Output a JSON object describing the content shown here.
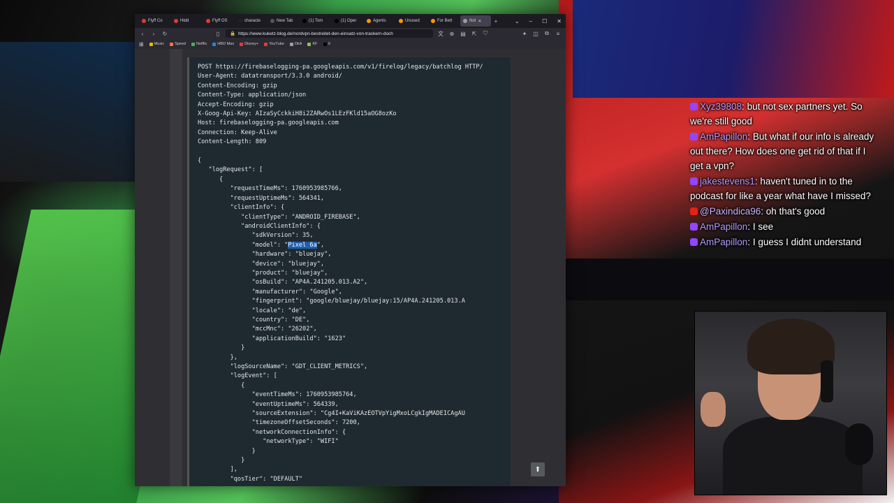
{
  "browser": {
    "tabs": [
      {
        "label": "Flyff Co",
        "color": "#e53935"
      },
      {
        "label": "Hidd",
        "color": "#e53935"
      },
      {
        "label": "Flyff OS",
        "color": "#e53935"
      },
      {
        "label": "characte",
        "color": "#222222"
      },
      {
        "label": "New Tab",
        "color": "#555555"
      },
      {
        "label": "(1) Tom",
        "color": "#000000"
      },
      {
        "label": "(1) Oper",
        "color": "#000000"
      },
      {
        "label": "Agents",
        "color": "#ff9800"
      },
      {
        "label": "Unused",
        "color": "#ff9800"
      },
      {
        "label": "For Bett",
        "color": "#ff9800"
      },
      {
        "label": "Not",
        "color": "#9e9e9e",
        "active": true
      }
    ],
    "url": "https://www.kuketz-blog.de/nordvpn-bestreitet-den-einsatz-von-trackern-doch",
    "bookmarks": [
      {
        "label": "Music",
        "color": "#f4b400"
      },
      {
        "label": "Speed",
        "color": "#ff7043"
      },
      {
        "label": "Netflix",
        "color": "#4caf50"
      },
      {
        "label": "HBO Max",
        "color": "#1e88e5"
      },
      {
        "label": "Disney+",
        "color": "#e53935"
      },
      {
        "label": "YouTube",
        "color": "#e53935"
      },
      {
        "label": "OkA",
        "color": "#9e9e9e"
      },
      {
        "label": "KF",
        "color": "#8bc34a"
      },
      {
        "label": "X",
        "color": "#000000"
      }
    ]
  },
  "code": {
    "before_highlight": "POST https://firebaselogging-pa.googleapis.com/v1/firelog/legacy/batchlog HTTP/\nUser-Agent: datatransport/3.3.0 android/\nContent-Encoding: gzip\nContent-Type: application/json\nAccept-Encoding: gzip\nX-Goog-Api-Key: AIzaSyCckkiH8i2ZARwOs1LEzFKld15aOG8ozKo\nHost: firebaselogging-pa.googleapis.com\nConnection: Keep-Alive\nContent-Length: 809\n\n{\n   \"logRequest\": [\n      {\n         \"requestTimeMs\": 1760953985766,\n         \"requestUptimeMs\": 564341,\n         \"clientInfo\": {\n            \"clientType\": \"ANDROID_FIREBASE\",\n            \"androidClientInfo\": {\n               \"sdkVersion\": 35,\n               \"model\": \"",
    "highlight": "Pixel 6a",
    "after_highlight": "\",\n               \"hardware\": \"bluejay\",\n               \"device\": \"bluejay\",\n               \"product\": \"bluejay\",\n               \"osBuild\": \"AP4A.241205.013.A2\",\n               \"manufacturer\": \"Google\",\n               \"fingerprint\": \"google/bluejay/bluejay:15/AP4A.241205.013.A\n               \"locale\": \"de\",\n               \"country\": \"DE\",\n               \"mccMnc\": \"26202\",\n               \"applicationBuild\": \"1623\"\n            }\n         },\n         \"logSourceName\": \"GDT_CLIENT_METRICS\",\n         \"logEvent\": [\n            {\n               \"eventTimeMs\": 1760953985764,\n               \"eventUptimeMs\": 564339,\n               \"sourceExtension\": \"Cg4I+KaViKAzEOTVpYigMxoLCgkIgMADEICAgAU\n               \"timezoneOffsetSeconds\": 7200,\n               \"networkConnectionInfo\": {\n                  \"networkType\": \"WIFI\"\n               }\n            }\n         ],\n         \"qosTier\": \"DEFAULT\""
  },
  "chat": [
    {
      "platform": "twitch",
      "user": "Xyz39808",
      "text": "but not sex partners yet. So we're still good"
    },
    {
      "platform": "twitch",
      "user": "AmPapillon",
      "text": "But what if our info is already out there? How does one get rid of that if I get a vpn?"
    },
    {
      "platform": "twitch",
      "user": "jakestevens1",
      "text": "haven't tuned in to the podcast for like a year what have I missed?"
    },
    {
      "platform": "youtube",
      "user": "@Paxindica96",
      "text": "oh that's good"
    },
    {
      "platform": "twitch",
      "user": "AmPapillon",
      "text": "I see"
    },
    {
      "platform": "twitch",
      "user": "AmPapillon",
      "text": "I guess I didnt understand"
    }
  ]
}
